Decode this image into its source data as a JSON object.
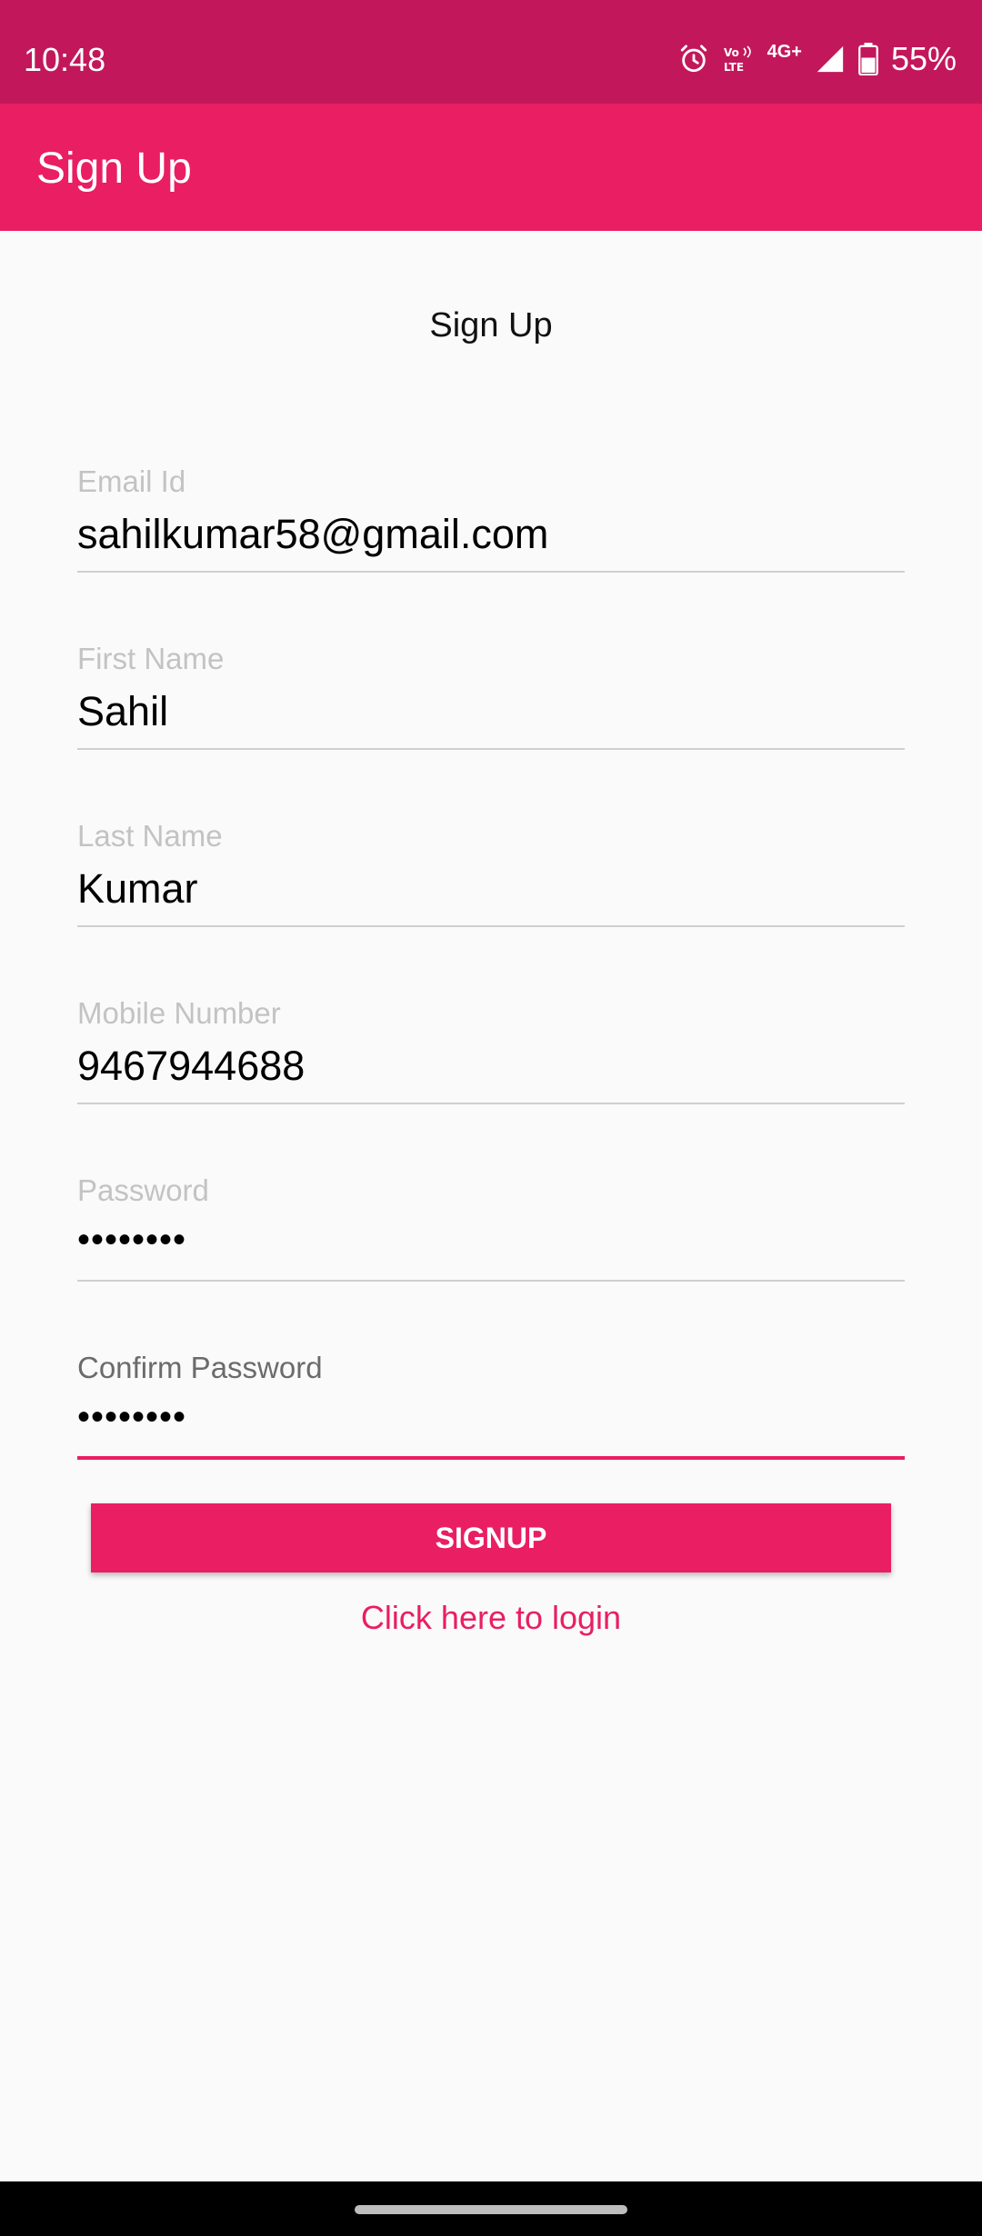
{
  "status_bar": {
    "time": "10:48",
    "network": "4G+",
    "volte_label": "Vo LTE",
    "battery": "55%",
    "icons": [
      "alarm-icon",
      "volte-icon",
      "signal-icon",
      "battery-icon"
    ]
  },
  "app_bar": {
    "title": "Sign Up"
  },
  "form": {
    "title": "Sign Up",
    "fields": [
      {
        "label": "Email Id",
        "value": "sahilkumar58@gmail.com"
      },
      {
        "label": "First Name",
        "value": "Sahil"
      },
      {
        "label": "Last Name",
        "value": "Kumar"
      },
      {
        "label": "Mobile Number",
        "value": "9467944688"
      },
      {
        "label": "Password",
        "value": "••••••••"
      },
      {
        "label": "Confirm Password",
        "value": "••••••••"
      }
    ],
    "submit_label": "SIGNUP",
    "login_link": "Click here to login"
  },
  "colors": {
    "status_bar": "#c2185b",
    "accent": "#e91e63",
    "background": "#fafafa"
  }
}
